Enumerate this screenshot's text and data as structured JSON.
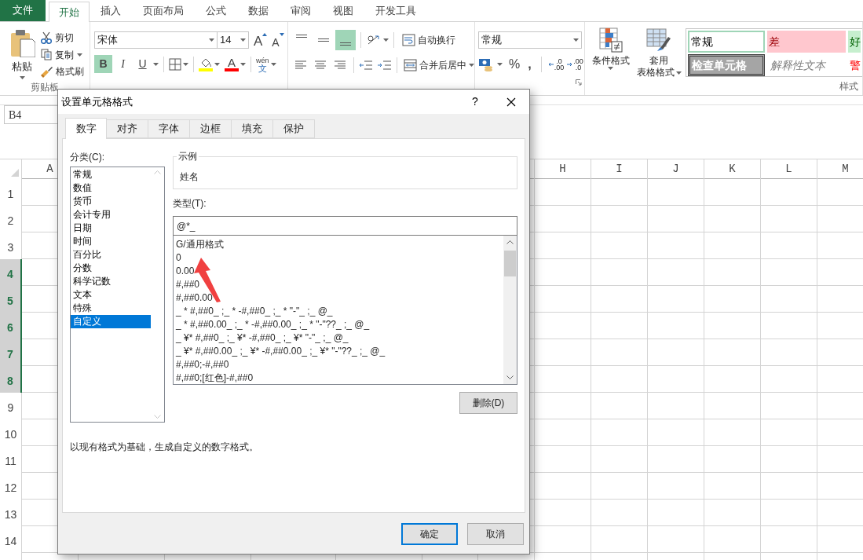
{
  "ribbon": {
    "file_tab": "文件",
    "tabs": [
      {
        "label": "开始",
        "selected": true
      },
      {
        "label": "插入",
        "selected": false
      },
      {
        "label": "页面布局",
        "selected": false
      },
      {
        "label": "公式",
        "selected": false
      },
      {
        "label": "数据",
        "selected": false
      },
      {
        "label": "审阅",
        "selected": false
      },
      {
        "label": "视图",
        "selected": false
      },
      {
        "label": "开发工具",
        "selected": false
      }
    ],
    "clipboard": {
      "paste": "粘贴",
      "cut": "剪切",
      "copy": "复制",
      "format_painter": "格式刷",
      "label": "剪贴板"
    },
    "font": {
      "name": "宋体",
      "size": "14",
      "grow": "A",
      "shrink": "A",
      "color_letter": "A",
      "phonetic_top": "wén",
      "phonetic_bottom": "文",
      "toggles": [
        {
          "label": "B",
          "kind": "bold",
          "selected": true
        },
        {
          "label": "I",
          "kind": "italic",
          "selected": false
        },
        {
          "label": "U",
          "kind": "underline",
          "selected": false
        }
      ]
    },
    "alignment": {
      "vertical": [
        {
          "kind": "top",
          "selected": false
        },
        {
          "kind": "middle",
          "selected": false
        },
        {
          "kind": "bottom",
          "selected": true
        }
      ],
      "wrap": "自动换行",
      "merge": "合并后居中"
    },
    "number": {
      "format": "常规",
      "percent": "%",
      "comma": ",",
      "increase_decimal": [
        ".0",
        ".00"
      ],
      "decrease_decimal": [
        ".00",
        ".0"
      ]
    },
    "styles": {
      "conditional": "条件格式",
      "table_format_top": "套用",
      "table_format_bottom": "表格格式",
      "label": "样式",
      "gallery": [
        {
          "label": "常规",
          "kind": "normal"
        },
        {
          "label": "差",
          "kind": "bad"
        },
        {
          "label": "好",
          "kind": "good"
        },
        {
          "label": "检查单元格",
          "kind": "check"
        },
        {
          "label": "解释性文本",
          "kind": "explanatory"
        },
        {
          "label": "警",
          "kind": "warning"
        }
      ]
    }
  },
  "name_box": "B4",
  "sheet": {
    "columns": [
      {
        "label": "A"
      },
      {
        "label": "H"
      },
      {
        "label": "I"
      },
      {
        "label": "J"
      },
      {
        "label": "K"
      },
      {
        "label": "L"
      },
      {
        "label": "M"
      }
    ],
    "rows": [
      {
        "label": "1",
        "selected": false
      },
      {
        "label": "2",
        "selected": false
      },
      {
        "label": "3",
        "selected": false
      },
      {
        "label": "4",
        "selected": true
      },
      {
        "label": "5",
        "selected": true
      },
      {
        "label": "6",
        "selected": true
      },
      {
        "label": "7",
        "selected": true
      },
      {
        "label": "8",
        "selected": true
      },
      {
        "label": "9",
        "selected": false
      },
      {
        "label": "10",
        "selected": false
      },
      {
        "label": "11",
        "selected": false
      },
      {
        "label": "12",
        "selected": false
      },
      {
        "label": "13",
        "selected": false
      },
      {
        "label": "14",
        "selected": false
      }
    ]
  },
  "dialog": {
    "title": "设置单元格格式",
    "help": "?",
    "tabs": [
      {
        "label": "数字",
        "selected": true
      },
      {
        "label": "对齐",
        "selected": false
      },
      {
        "label": "字体",
        "selected": false
      },
      {
        "label": "边框",
        "selected": false
      },
      {
        "label": "填充",
        "selected": false
      },
      {
        "label": "保护",
        "selected": false
      }
    ],
    "category_label": "分类(C):",
    "categories": [
      {
        "label": "常规",
        "selected": false
      },
      {
        "label": "数值",
        "selected": false
      },
      {
        "label": "货币",
        "selected": false
      },
      {
        "label": "会计专用",
        "selected": false
      },
      {
        "label": "日期",
        "selected": false
      },
      {
        "label": "时间",
        "selected": false
      },
      {
        "label": "百分比",
        "selected": false
      },
      {
        "label": "分数",
        "selected": false
      },
      {
        "label": "科学记数",
        "selected": false
      },
      {
        "label": "文本",
        "selected": false
      },
      {
        "label": "特殊",
        "selected": false
      },
      {
        "label": "自定义",
        "selected": true
      }
    ],
    "sample_label": "示例",
    "sample": "姓名",
    "type_label": "类型(T):",
    "type_value": "@*_",
    "formats": [
      "G/通用格式",
      "0",
      "0.00",
      "#,##0",
      "#,##0.00",
      "_ * #,##0_ ;_ * -#,##0_ ;_ * \"-\"_ ;_ @_",
      "_ * #,##0.00_ ;_ * -#,##0.00_ ;_ * \"-\"??_ ;_ @_",
      "_ ¥* #,##0_ ;_ ¥* -#,##0_ ;_ ¥* \"-\"_ ;_ @_",
      "_ ¥* #,##0.00_ ;_ ¥* -#,##0.00_ ;_ ¥* \"-\"??_ ;_ @_",
      "#,##0;-#,##0",
      "#,##0;[红色]-#,##0"
    ],
    "delete": "删除(D)",
    "description": "以现有格式为基础，生成自定义的数字格式。",
    "ok": "确定",
    "cancel": "取消"
  }
}
